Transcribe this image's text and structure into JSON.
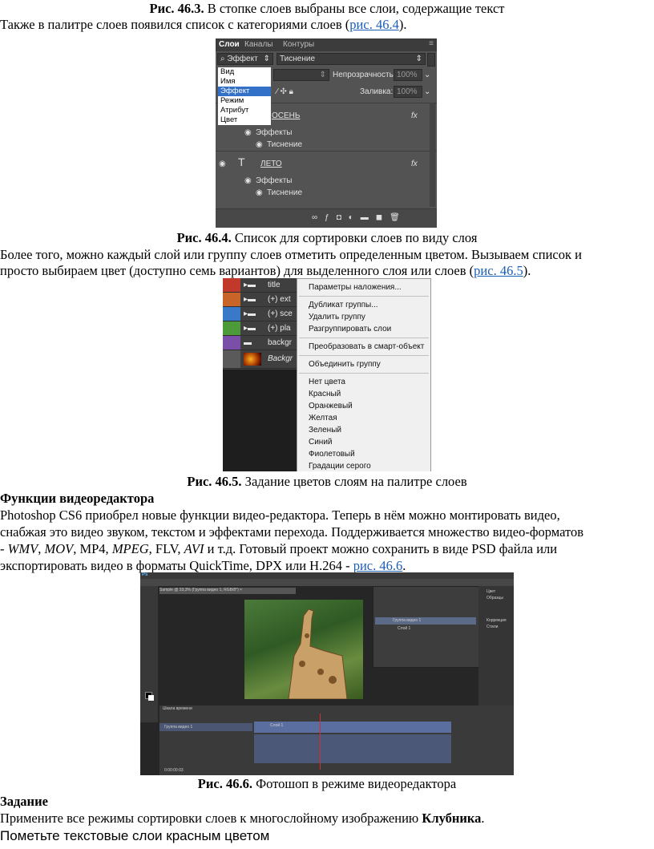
{
  "para1": {
    "caption_label": "Рис. 46.3.",
    "caption_text": " В стопке слоев выбраны все слои, содержащие текст"
  },
  "para2": {
    "text": "Также в палитре слоев появился список с категориями слоев (",
    "link": "рис. 46.4",
    "tail": ")."
  },
  "fig464": {
    "tabs": [
      "Слои",
      "Каналы",
      "Контуры"
    ],
    "filter_label": "Эффект",
    "filter_value": "Тиснение",
    "menu_items": [
      "Вид",
      "Имя",
      "Эффект",
      "Режим",
      "Атрибут",
      "Цвет"
    ],
    "selected_item": "Эффект",
    "opacity_label": "Непрозрачность:",
    "opacity_value": "100%",
    "fill_label": "Заливка:",
    "fill_value": "100%",
    "layer1_name": "ОСЕНЬ",
    "layer2_name": "ЛЕТО",
    "effects_label": "Эффекты",
    "emboss_label": "Тиснение",
    "fx": "fx",
    "caption_label": "Рис. 46.4.",
    "caption_text": " Список для сортировки слоев по виду слоя"
  },
  "para3": {
    "line1": "Более того, можно каждый слой или группу слоев отметить определенным цветом. Вызываем список и",
    "line2": "просто выбираем цвет (доступно семь вариантов) для выделенного слоя или слоев (",
    "link": "рис. 46.5",
    "tail": ")."
  },
  "fig465": {
    "layers": [
      {
        "name": "title",
        "color": "#c0392b"
      },
      {
        "name": "(+) ext",
        "color": "#c86428"
      },
      {
        "name": "(+) sce",
        "color": "#3a78c8"
      },
      {
        "name": "(+) pla",
        "color": "#4c9a3a"
      },
      {
        "name": "backgr",
        "color": "#7b4ea8"
      },
      {
        "name": "Backgr",
        "color": "#5a5a5a"
      }
    ],
    "menu": [
      "Параметры наложения...",
      "Дубликат группы...",
      "Удалить группу",
      "Разгруппировать слои",
      "Преобразовать в смарт-объект",
      "Объединить группу",
      "Нет цвета",
      "Красный",
      "Оранжевый",
      "Желтая",
      "Зеленый",
      "Синий",
      "Фиолетовый",
      "Градации серого"
    ],
    "caption_label": "Рис. 46.5.",
    "caption_text": " Задание цветов слоям на палитре слоев"
  },
  "section_title": "Функции видеоредактора",
  "para4": {
    "line1": "Photoshop CS6 приобрел новые функции видео-редактора. Теперь в нём можно монтировать видео,",
    "line2": "снабжая это видео звуком, текстом и эффектами перехода. Поддерживается множество видео-форматов",
    "l3a": "- ",
    "wmv": "WMV",
    "c1": ", ",
    "mov": "MOV",
    "c2": ", MP4, ",
    "mpeg": "MPEG",
    "c3": ", FLV, ",
    "avi": "AVI",
    "c4": " и т.д. Готовый проект можно сохранить в виде PSD файла или",
    "line4": "экспортировать видео в форматы QuickTime, DPX или H.264 - ",
    "link": "рис. 46.6",
    "tail": "."
  },
  "fig466": {
    "doc_tab": "Sample @ 33,3% (Группа видео 1, RGB/8*) ×",
    "timeline_tab": "Шкала времени",
    "track1": "Группа видео 1",
    "clip1": "Слой 1",
    "layer_group": "Группа видео 1",
    "layer_item": "Слой 1",
    "panel_items": [
      "Цвет",
      "Образцы",
      "Коррекция",
      "Стили"
    ],
    "time": "0:00:00:03",
    "caption_label": "Рис. 46.6.",
    "caption_text": " Фотошоп в режиме видеоредактора"
  },
  "task_title": "Задание",
  "task": {
    "text": "Примените все режимы сортировки слоев к многослойному изображению ",
    "bold": "Клубника",
    "tail": "."
  },
  "last_line": "Пометьте текстовые слои красным цветом"
}
